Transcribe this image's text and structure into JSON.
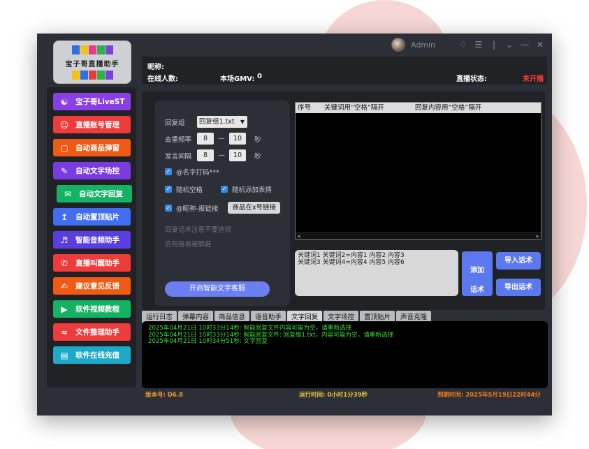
{
  "app": {
    "logo_text": "宝子哥直播助手",
    "user": "Admin"
  },
  "info": {
    "nickname_label": "昵称:",
    "online_label": "在线人数:",
    "gmv_label": "本场GMV:",
    "gmv_value": "0",
    "live_status_label": "直播状态:",
    "live_status_value": "未开播"
  },
  "sidebar": {
    "items": [
      {
        "label": "宝子哥LiveST",
        "color": "#8a3fe6"
      },
      {
        "label": "直播账号管理",
        "color": "#ee3b3b"
      },
      {
        "label": "自动商品弹窗",
        "color": "#f05a13"
      },
      {
        "label": "自动文字场控",
        "color": "#7a3be0"
      },
      {
        "label": "自动文字回复",
        "color": "#14b364"
      },
      {
        "label": "自动置顶贴片",
        "color": "#3f6ef0"
      },
      {
        "label": "智能音频助手",
        "color": "#5a3ee0"
      },
      {
        "label": "直播叫醒助手",
        "color": "#ee3b3b"
      },
      {
        "label": "建议意见反馈",
        "color": "#f05a13"
      },
      {
        "label": "软件视频教程",
        "color": "#14b364"
      },
      {
        "label": "文件整理助手",
        "color": "#ee3b3b"
      },
      {
        "label": "软件在线充值",
        "color": "#1da9c8"
      }
    ]
  },
  "form": {
    "group_label": "回复组",
    "group_value": "回复组1.txt",
    "dedupe_label": "去重频率",
    "dedupe_min": "8",
    "dedupe_max": "10",
    "interval_label": "发言间隔",
    "interval_min": "8",
    "interval_max": "10",
    "unit_sec": "秒",
    "dash": "—",
    "check1": "@名字打码***",
    "check2": "随机空格",
    "check3": "随机添加表情",
    "check4": "@昵称-报链接",
    "link_button": "商品在x号链接",
    "note1": "回复话术注意不要违规",
    "note2": "否则容易被屏蔽",
    "start_button": "开启智能文字客服"
  },
  "table": {
    "headers": [
      "序号",
      "关键词用“空格”隔开",
      "回复内容用“空格”隔开"
    ]
  },
  "textarea": {
    "line1": "关键词1 关键词2=内容1 内容2 内容3",
    "line2": "关键词3 关键词4=内容4 内容5 内容6"
  },
  "buttons": {
    "add_line1": "添加",
    "add_line2": "话术",
    "import": "导入话术",
    "export": "导出话术"
  },
  "tabs": [
    "运行日志",
    "弹幕内容",
    "商品信息",
    "语音助手",
    "文字回复",
    "文字场控",
    "置顶贴片",
    "声音克隆"
  ],
  "log": [
    "2025年04月21日  10时33分14秒:  智能回复文件内容可能为空，请重新选择",
    "2025年04月21日  10时33分14秒:  智能回复文件: 回复组1.txt，内容可能为空，请重新选择",
    "2025年04月21日  10时34分51秒:  文字回复"
  ],
  "status": {
    "version": "版本号: D6.8",
    "runtime": "运行时间: 0小时1分39秒",
    "expire": "到期时间: 2025年5月19日22时44分"
  }
}
